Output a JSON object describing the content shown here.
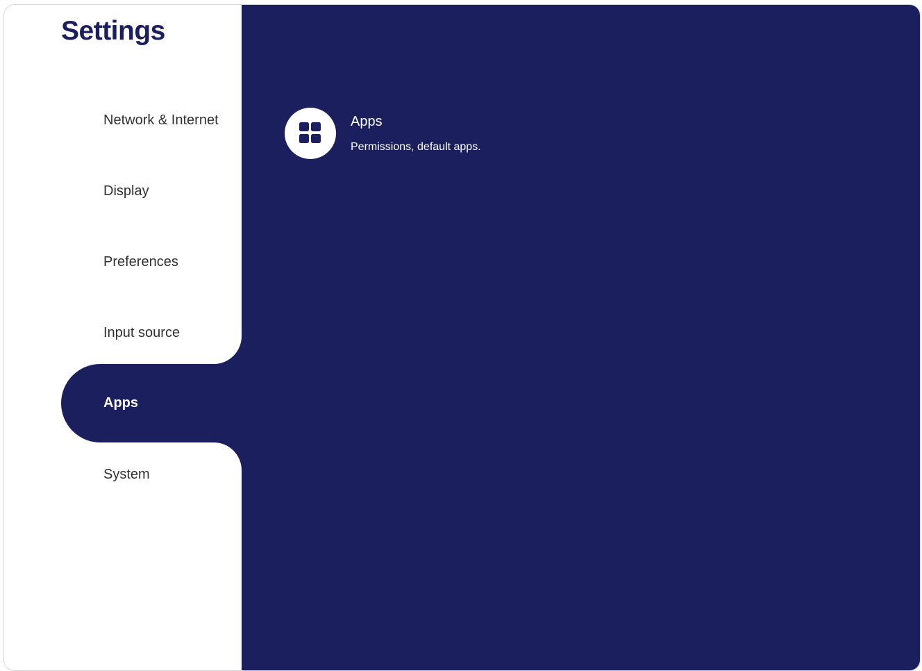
{
  "header": {
    "title": "Settings"
  },
  "sidebar": {
    "items": [
      {
        "label": "Network & Internet",
        "selected": false
      },
      {
        "label": "Display",
        "selected": false
      },
      {
        "label": "Preferences",
        "selected": false
      },
      {
        "label": "Input source",
        "selected": false
      },
      {
        "label": "Apps",
        "selected": true
      },
      {
        "label": "System",
        "selected": false
      }
    ]
  },
  "main": {
    "entries": [
      {
        "icon": "grid-apps-icon",
        "title": "Apps",
        "subtitle": "Permissions, default apps."
      }
    ]
  },
  "colors": {
    "accent": "#1c1f5e",
    "background": "#ffffff",
    "text": "#303030"
  }
}
